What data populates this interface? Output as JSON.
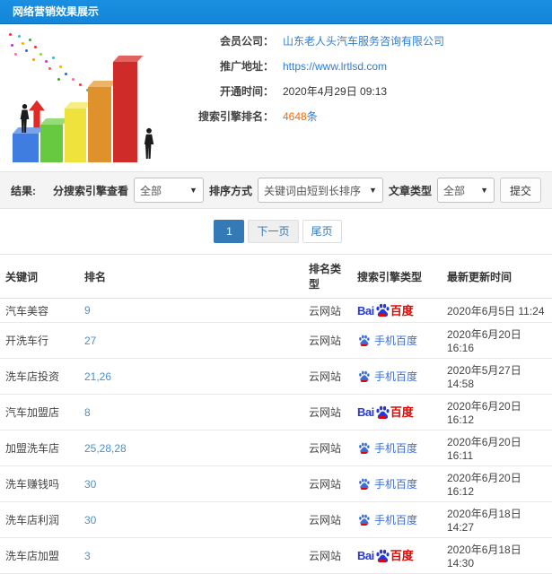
{
  "colors": {
    "header_blue": "#1486d9",
    "link_blue": "#2e7cd9",
    "count_orange": "#ff6600",
    "rank_blue": "#4a90cf",
    "active_page_blue": "#337ab7",
    "baidu_blue": "#2439dc",
    "baidu_red": "#e10601",
    "mobile_blue": "#3a6fd8"
  },
  "header": {
    "title": "网络营销效果展示"
  },
  "info": {
    "company_label": "会员公司：",
    "company_value": "山东老人头汽车服务咨询有限公司",
    "url_label": "推广地址：",
    "url_value": "https://www.lrtlsd.com",
    "open_time_label": "开通时间：",
    "open_time_value": "2020年4月29日 09:13",
    "rank_label": "搜索引擎排名：",
    "rank_value": "4648",
    "rank_unit": "条"
  },
  "filters": {
    "section_label": "结果:",
    "engine_label": "分搜索引擎查看",
    "engine_value": "全部",
    "sort_label": "排序方式",
    "sort_value": "关键词由短到长排序",
    "type_label": "文章类型",
    "type_value": "全部",
    "submit_label": "提交",
    "caret": "▼"
  },
  "pagination": {
    "current": "1",
    "next": "下一页",
    "last": "尾页"
  },
  "table": {
    "headers": [
      "关键词",
      "排名",
      "排名类型",
      "搜索引擎类型",
      "最新更新时间"
    ],
    "engines": {
      "pc": {
        "bai": "Bai",
        "du": "百度"
      },
      "mobile": {
        "label": "手机百度"
      }
    },
    "rows": [
      {
        "keyword": "汽车美容",
        "rank": "9",
        "rank_type": "云网站",
        "engine": "pc",
        "updated": "2020年6月5日 11:24"
      },
      {
        "keyword": "开洗车行",
        "rank": "27",
        "rank_type": "云网站",
        "engine": "mobile",
        "updated": "2020年6月20日 16:16"
      },
      {
        "keyword": "洗车店投资",
        "rank": "21,26",
        "rank_type": "云网站",
        "engine": "mobile",
        "updated": "2020年5月27日 14:58"
      },
      {
        "keyword": "汽车加盟店",
        "rank": "8",
        "rank_type": "云网站",
        "engine": "pc",
        "updated": "2020年6月20日 16:12"
      },
      {
        "keyword": "加盟洗车店",
        "rank": "25,28,28",
        "rank_type": "云网站",
        "engine": "mobile",
        "updated": "2020年6月20日 16:11"
      },
      {
        "keyword": "洗车赚钱吗",
        "rank": "30",
        "rank_type": "云网站",
        "engine": "mobile",
        "updated": "2020年6月20日 16:12"
      },
      {
        "keyword": "洗车店利润",
        "rank": "30",
        "rank_type": "云网站",
        "engine": "mobile",
        "updated": "2020年6月18日 14:27"
      },
      {
        "keyword": "洗车店加盟",
        "rank": "3",
        "rank_type": "云网站",
        "engine": "pc",
        "updated": "2020年6月18日 14:30"
      }
    ]
  }
}
